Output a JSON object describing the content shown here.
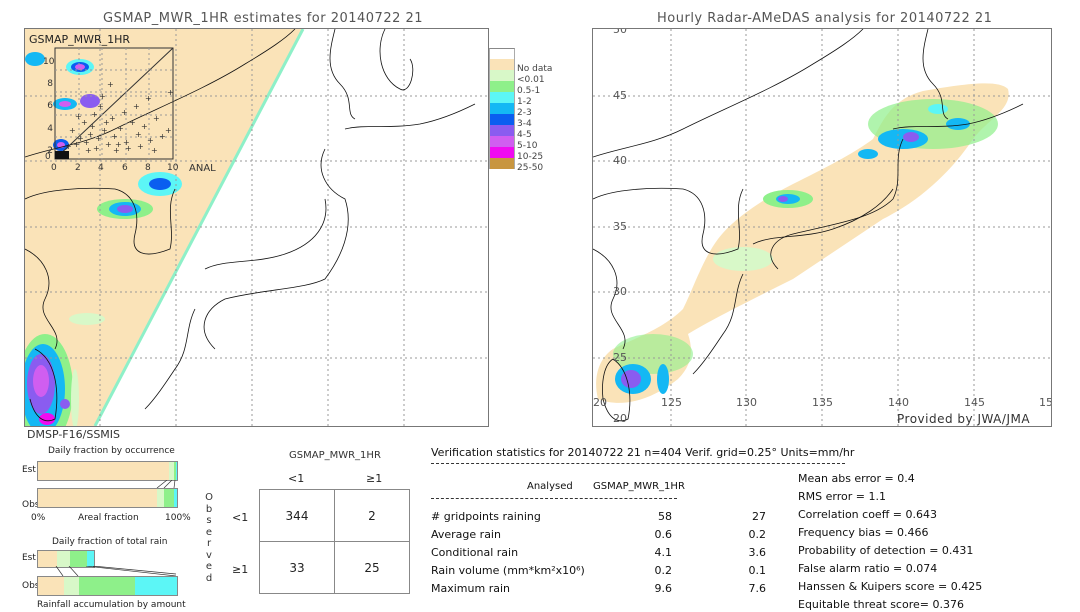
{
  "left_map": {
    "title": "GSMAP_MWR_1HR estimates for 20140722 21",
    "inset_label": "GSMAP_MWR_1HR",
    "inset_x_label": "ANAL",
    "inset_yticks": [
      "10",
      "8",
      "6",
      "4",
      "2",
      "0"
    ],
    "inset_xticks": [
      "0",
      "2",
      "4",
      "6",
      "8",
      "10"
    ],
    "satellite_label": "DMSP-F16/SSMIS"
  },
  "right_map": {
    "title": "Hourly Radar-AMeDAS analysis for 20140722 21",
    "lat_ticks": [
      "45",
      "40",
      "35",
      "30",
      "25",
      "20"
    ],
    "lon_ticks": [
      "125",
      "130",
      "135",
      "140",
      "145",
      "15"
    ],
    "top_lat_tick": "50",
    "left_lon_tick": "20",
    "credit": "Provided by JWA/JMA"
  },
  "legend": {
    "items": [
      {
        "label": "",
        "color": "#ffffff"
      },
      {
        "label": "No data",
        "color": "#fae3b8"
      },
      {
        "label": "<0.01",
        "color": "#d8f8c8"
      },
      {
        "label": "0.5-1",
        "color": "#8ef08a"
      },
      {
        "label": "1-2",
        "color": "#5cf6f6"
      },
      {
        "label": "2-3",
        "color": "#14b8f4"
      },
      {
        "label": "3-4",
        "color": "#0a5ef0"
      },
      {
        "label": "4-5",
        "color": "#8a5cf0"
      },
      {
        "label": "5-10",
        "color": "#d05ef0"
      },
      {
        "label": "10-25",
        "color": "#f00af0"
      },
      {
        "label": "25-50",
        "color": "#c89640"
      }
    ]
  },
  "occurrence_chart": {
    "title": "Daily fraction by occurrence",
    "est_label": "Est",
    "obs_label": "Obs",
    "x_left": "0%",
    "x_mid": "Areal fraction",
    "x_right": "100%",
    "est_segments": [
      {
        "fraction": 0.94,
        "color": "#fae3b8"
      },
      {
        "fraction": 0.035,
        "color": "#d8f8c8"
      },
      {
        "fraction": 0.02,
        "color": "#8ef08a"
      },
      {
        "fraction": 0.005,
        "color": "#5cf6f6"
      }
    ],
    "obs_segments": [
      {
        "fraction": 0.855,
        "color": "#fae3b8"
      },
      {
        "fraction": 0.05,
        "color": "#d8f8c8"
      },
      {
        "fraction": 0.075,
        "color": "#8ef08a"
      },
      {
        "fraction": 0.02,
        "color": "#5cf6f6"
      }
    ]
  },
  "total_rain_chart": {
    "title": "Daily fraction of total rain",
    "est_label": "Est",
    "obs_label": "Obs",
    "footer": "Rainfall accumulation by amount",
    "est_segments": [
      {
        "fraction": 0.135,
        "color": "#fae3b8"
      },
      {
        "fraction": 0.095,
        "color": "#d8f8c8"
      },
      {
        "fraction": 0.12,
        "color": "#8ef08a"
      },
      {
        "fraction": 0.05,
        "color": "#5cf6f6"
      }
    ],
    "obs_segments": [
      {
        "fraction": 0.185,
        "color": "#fae3b8"
      },
      {
        "fraction": 0.11,
        "color": "#d8f8c8"
      },
      {
        "fraction": 0.405,
        "color": "#8ef08a"
      },
      {
        "fraction": 0.3,
        "color": "#5cf6f6"
      }
    ]
  },
  "contingency": {
    "model_label": "GSMAP_MWR_1HR",
    "col_lt": "<1",
    "col_ge": "≥1",
    "row_lt": "<1",
    "row_ge": "≥1",
    "observed_letters": [
      "O",
      "b",
      "s",
      "e",
      "r",
      "v",
      "e",
      "d"
    ],
    "cells": {
      "lt_lt": "344",
      "lt_ge": "2",
      "ge_lt": "33",
      "ge_ge": "25"
    }
  },
  "verification": {
    "header": "Verification statistics for 20140722 21   n=404   Verif. grid=0.25°   Units=mm/hr",
    "col_analysed": "Analysed",
    "col_model": "GSMAP_MWR_1HR",
    "rows": [
      {
        "label": "# gridpoints raining",
        "analysed": "58",
        "model": "27"
      },
      {
        "label": "Average rain",
        "analysed": "0.6",
        "model": "0.2"
      },
      {
        "label": "Conditional rain",
        "analysed": "4.1",
        "model": "3.6"
      },
      {
        "label": "Rain volume (mm*km²x10⁶)",
        "analysed": "0.2",
        "model": "0.1"
      },
      {
        "label": "Maximum rain",
        "analysed": "9.6",
        "model": "7.6"
      }
    ],
    "scores": [
      "Mean abs error = 0.4",
      "RMS error = 1.1",
      "Correlation coeff = 0.643",
      "Frequency bias = 0.466",
      "Probability of detection = 0.431",
      "False alarm ratio = 0.074",
      "Hanssen & Kuipers score = 0.425",
      "Equitable threat score= 0.376"
    ]
  }
}
